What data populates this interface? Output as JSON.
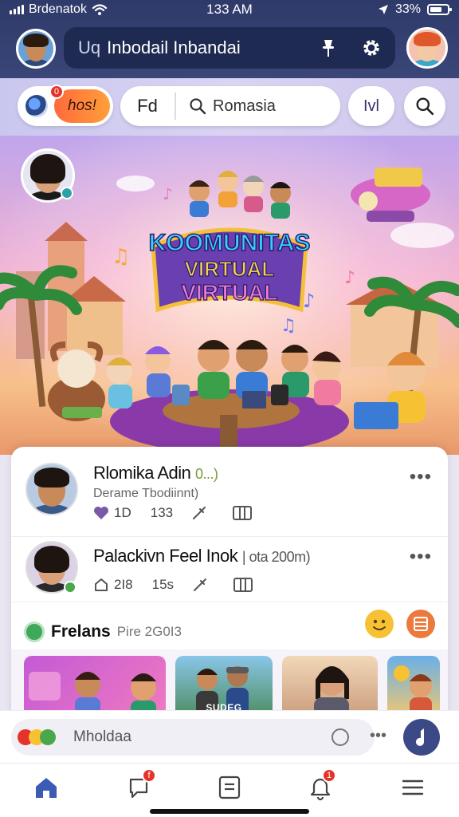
{
  "status_bar": {
    "carrier": "Brdenatok",
    "time": "133 AM",
    "battery": "33%"
  },
  "header": {
    "search_prefix": "Uq",
    "search_text": "Inbodail Inbandai",
    "icons": [
      "pin-icon",
      "gear-icon"
    ]
  },
  "filters": {
    "hot_label": "hos!",
    "hot_badge": "0",
    "fd_label": "Fd",
    "location_value": "Romasia",
    "level_label": "Ivl",
    "search_icon": "search-icon"
  },
  "hero": {
    "title_line1": "KOOMUNITAS",
    "title_line2": "VIRTUAL",
    "title_line3": "VIRTUAL"
  },
  "posts": [
    {
      "name": "Rlomika Adin",
      "name_suffix": "0...)",
      "subtitle": "Derame Tbodiinnt)",
      "likes": "1D",
      "comments": "133",
      "more": "•••"
    },
    {
      "name": "Palackivn Feel Inok",
      "name_suffix": "| ota 200m)",
      "likes": "2I8",
      "comments": "15s",
      "more": "•••"
    }
  ],
  "friends": {
    "title": "Frelans",
    "subtitle": "Pire 2G0I3",
    "thumb_label": "SUDEG"
  },
  "compose": {
    "placeholder": "Mholdaa",
    "more": "•••"
  },
  "nav": {
    "active": "home",
    "badges": [
      "f",
      "1"
    ]
  },
  "colors": {
    "header_bg": "#2e3a69",
    "accent_orange": "#ff7a3a",
    "nav_active": "#3b5bb5",
    "badge_red": "#e6332a"
  }
}
